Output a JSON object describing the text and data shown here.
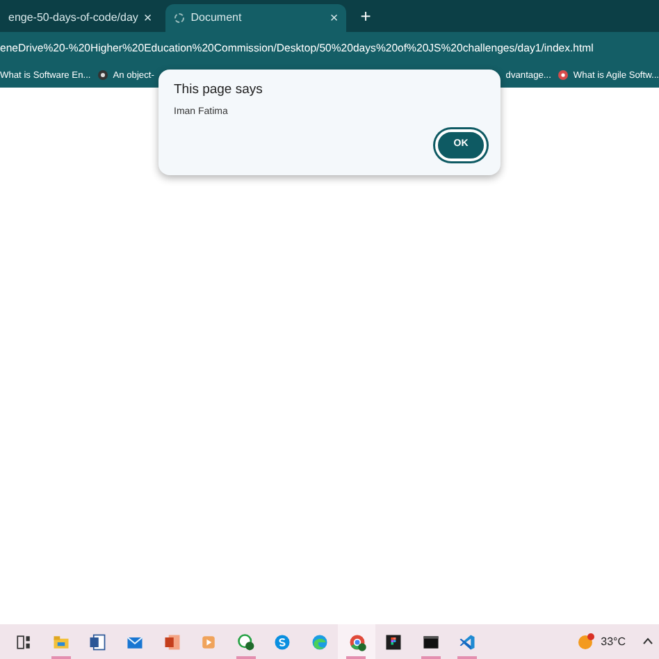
{
  "tabs": [
    {
      "title": "enge-50-days-of-code/day",
      "selected": false,
      "close": "×"
    },
    {
      "title": "Document",
      "selected": true,
      "close": "×"
    }
  ],
  "new_tab": "+",
  "address": "eneDrive%20-%20Higher%20Education%20Commission/Desktop/50%20days%20of%20JS%20challenges/day1/index.html",
  "bookmarks": [
    {
      "label": "What is Software En...",
      "kind": "none"
    },
    {
      "label": "An object-",
      "kind": "dark"
    },
    {
      "label": "dvantage...",
      "kind": "none"
    },
    {
      "label": "What is Agile Softw...",
      "kind": "red"
    }
  ],
  "dialog": {
    "title": "This page says",
    "message": "Iman Fatima",
    "ok": "OK"
  },
  "taskbar": {
    "apps": [
      {
        "kind": "taskview",
        "running": false,
        "active": false
      },
      {
        "kind": "explorer",
        "running": true,
        "active": false
      },
      {
        "kind": "word",
        "running": false,
        "active": false
      },
      {
        "kind": "mail",
        "running": false,
        "active": false
      },
      {
        "kind": "powerpoint",
        "running": false,
        "active": false
      },
      {
        "kind": "media",
        "running": false,
        "active": false
      },
      {
        "kind": "whatsapp",
        "running": true,
        "active": false
      },
      {
        "kind": "skype",
        "running": false,
        "active": false
      },
      {
        "kind": "edge",
        "running": false,
        "active": false
      },
      {
        "kind": "chrome",
        "running": true,
        "active": true
      },
      {
        "kind": "figma",
        "running": false,
        "active": false
      },
      {
        "kind": "terminal",
        "running": true,
        "active": false
      },
      {
        "kind": "vscode",
        "running": true,
        "active": false
      }
    ],
    "temperature": "33°C"
  }
}
